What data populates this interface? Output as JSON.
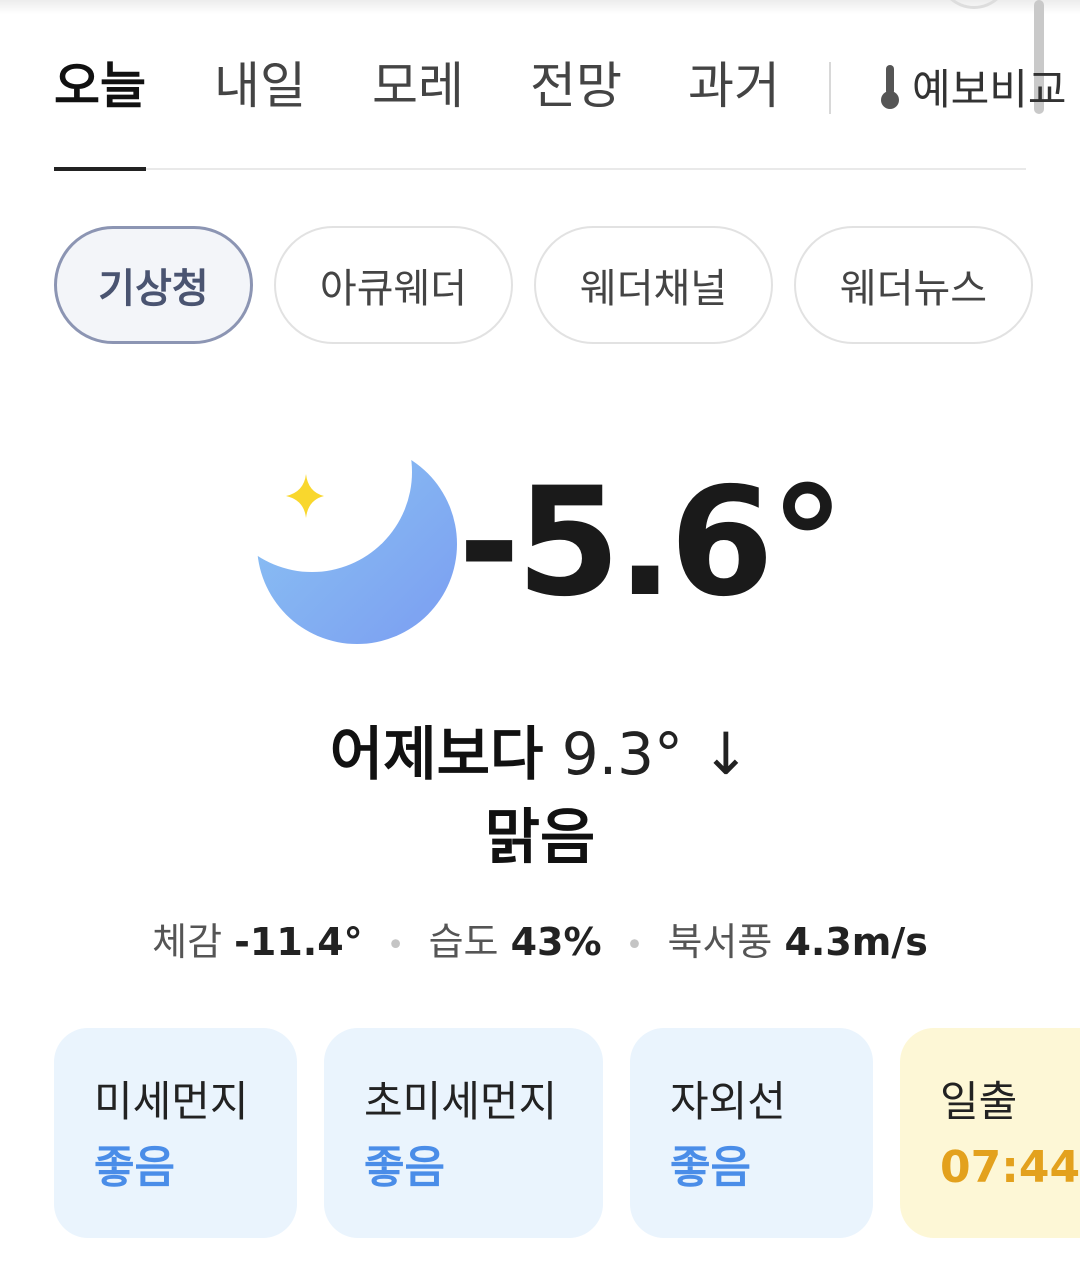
{
  "tabs": [
    {
      "label": "오늘",
      "active": true
    },
    {
      "label": "내일",
      "active": false
    },
    {
      "label": "모레",
      "active": false
    },
    {
      "label": "전망",
      "active": false
    },
    {
      "label": "과거",
      "active": false
    }
  ],
  "compare_tab": {
    "label": "예보비교",
    "icon": "thermometer-icon"
  },
  "sources": [
    {
      "label": "기상청",
      "selected": true
    },
    {
      "label": "아큐웨더",
      "selected": false
    },
    {
      "label": "웨더채널",
      "selected": false
    },
    {
      "label": "웨더뉴스",
      "selected": false
    }
  ],
  "current": {
    "icon": "moon-star-icon",
    "temperature": "-5.6°",
    "compare_label": "어제보다",
    "compare_value": "9.3° ↓",
    "condition": "맑음",
    "feels_label": "체감",
    "feels_value": "-11.4°",
    "humidity_label": "습도",
    "humidity_value": "43%",
    "wind_label": "북서풍",
    "wind_value": "4.3m/s"
  },
  "cards": [
    {
      "title": "미세먼지",
      "value": "좋음",
      "tone": "blue"
    },
    {
      "title": "초미세먼지",
      "value": "좋음",
      "tone": "blue"
    },
    {
      "title": "자외선",
      "value": "좋음",
      "tone": "blue"
    },
    {
      "title": "일출",
      "value": "07:44",
      "tone": "yellow"
    }
  ],
  "colors": {
    "card_blue_bg": "#eaf4fd",
    "card_blue_value": "#4a8de8",
    "card_yellow_bg": "#fdf7d6",
    "card_yellow_value": "#e3a11d",
    "moon": "#7fb0f2",
    "star": "#f9d72d"
  }
}
